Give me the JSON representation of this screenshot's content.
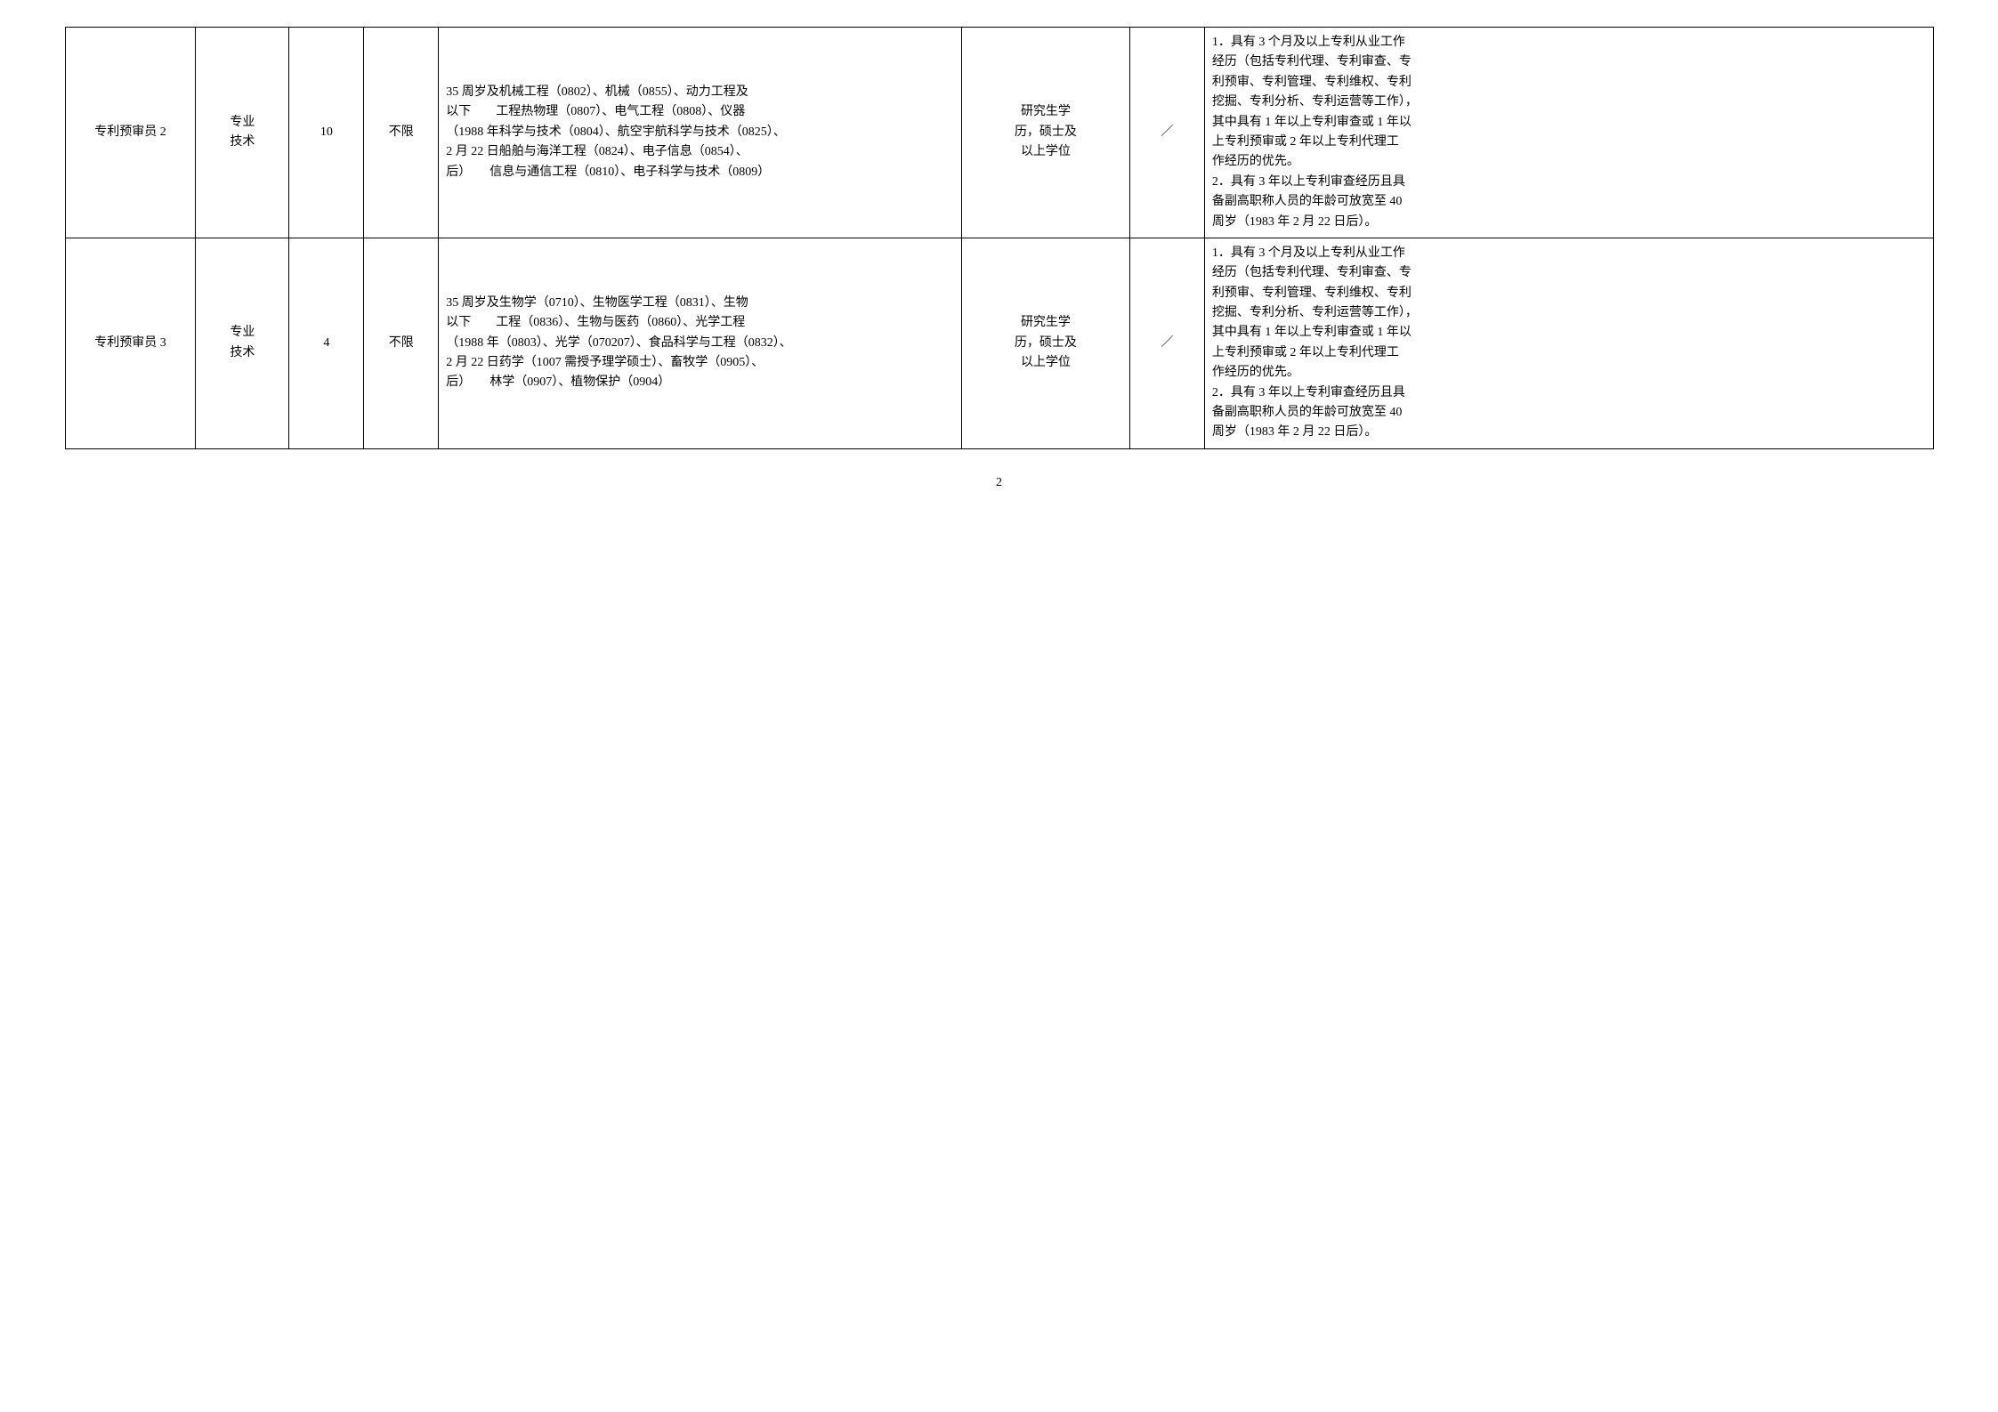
{
  "table": {
    "rows": [
      {
        "position": "专利预审员 2",
        "type": "专业\n技术",
        "count": "10",
        "limit": "不限",
        "age_major": "35 周岁及\n以下\n（1988 年\n2 月 22 日\n后）",
        "major_detail": "机械工程（0802）、机械（0855）、动力工程及\n工程热物理（0807）、电气工程（0808）、仪器\n科学与技术（0804）、航空宇航科学与技术（0825）、\n船舶与海洋工程（0824）、电子信息（0854）、\n信息与通信工程（0810）、电子科学与技术（0809）",
        "edu": "研究生学\n历，硕士及\n以上学位",
        "other": "／",
        "requirements": "1．具有 3 个月及以上专利从业工作\n经历（包括专利代理、专利审查、专\n利预审、专利管理、专利维权、专利\n挖掘、专利分析、专利运营等工作），\n其中具有 1 年以上专利审查或 1 年以\n上专利预审或 2 年以上专利代理工\n作经历的优先。\n2．具有 3 年以上专利审查经历且具\n备副高职称人员的年龄可放宽至 40\n周岁（1983 年 2 月 22 日后）。"
      },
      {
        "position": "专利预审员 3",
        "type": "专业\n技术",
        "count": "4",
        "limit": "不限",
        "age_major": "35 周岁及\n以下\n（1988 年\n2 月 22 日\n后）",
        "major_detail": "生物学（0710）、生物医学工程（0831）、生物\n工程（0836）、生物与医药（0860）、光学工程\n（0803）、光学（070207）、食品科学与工程（0832）、\n药学（1007 需授予理学硕士）、畜牧学（0905）、\n林学（0907）、植物保护（0904）",
        "edu": "研究生学\n历，硕士及\n以上学位",
        "other": "／",
        "requirements": "1．具有 3 个月及以上专利从业工作\n经历（包括专利代理、专利审查、专\n利预审、专利管理、专利维权、专利\n挖掘、专利分析、专利运营等工作），\n其中具有 1 年以上专利审查或 1 年以\n上专利预审或 2 年以上专利代理工\n作经历的优先。\n2．具有 3 年以上专利审查经历且具\n备副高职称人员的年龄可放宽至 40\n周岁（1983 年 2 月 22 日后）。"
      }
    ]
  },
  "page_number": "2"
}
